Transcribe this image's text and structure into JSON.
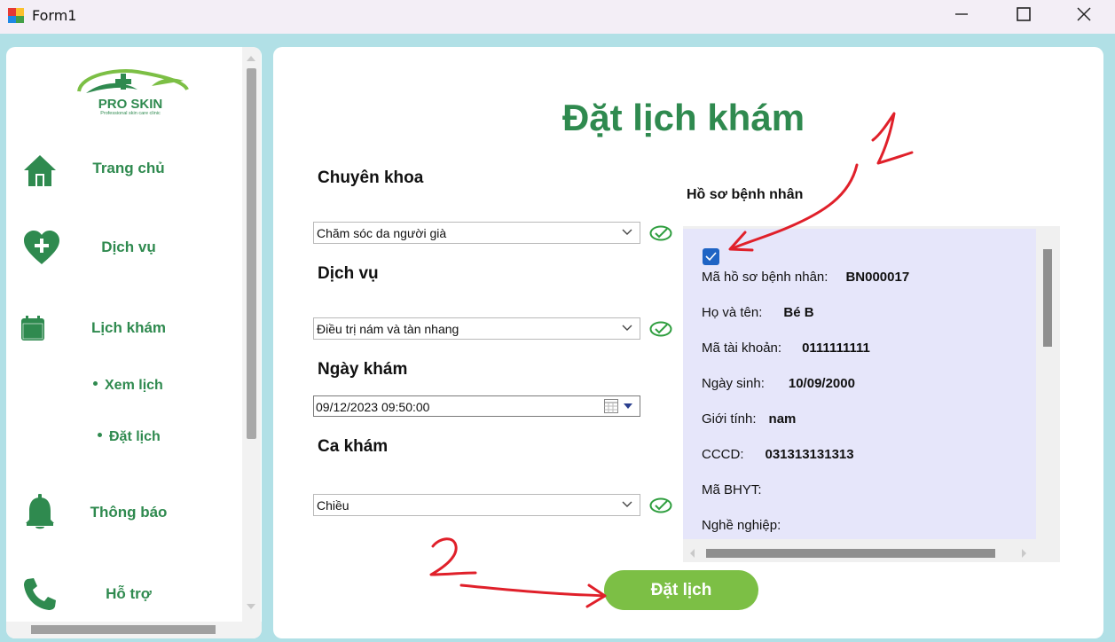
{
  "window": {
    "title": "Form1"
  },
  "colors": {
    "accent_green": "#2f8a4f",
    "button_green": "#7cbf45",
    "panel_lavender": "#e6e6fa",
    "annotation_red": "#e0202a"
  },
  "sidebar": {
    "logo_text": "PRO SKIN",
    "logo_tagline": "Professional skin care clinic",
    "items": [
      {
        "label": "Trang chủ",
        "icon": "home-icon"
      },
      {
        "label": "Dịch vụ",
        "icon": "heart-plus-icon"
      },
      {
        "label": "Lịch khám",
        "icon": "calendar-icon"
      },
      {
        "label": "Thông báo",
        "icon": "bell-icon"
      },
      {
        "label": "Hỗ trợ",
        "icon": "phone-icon"
      }
    ],
    "sub_items": [
      {
        "label": "Xem lịch"
      },
      {
        "label": "Đặt lịch"
      }
    ]
  },
  "main": {
    "title": "Đặt lịch khám",
    "specialty": {
      "label": "Chuyên khoa",
      "value": "Chăm sóc da người già"
    },
    "service": {
      "label": "Dịch vụ",
      "value": "Điều trị nám và tàn nhang"
    },
    "date": {
      "label": "Ngày khám",
      "value": "09/12/2023 09:50:00"
    },
    "shift": {
      "label": "Ca khám",
      "value": "Chiều"
    },
    "profile": {
      "heading": "Hồ sơ bệnh nhân",
      "checked": true,
      "fields": [
        {
          "label": "Mã hồ sơ bệnh nhân:",
          "value": "BN000017"
        },
        {
          "label": "Họ và tên:",
          "value": "Bé B"
        },
        {
          "label": "Mã tài khoản:",
          "value": "0111111111"
        },
        {
          "label": "Ngày sinh:",
          "value": "10/09/2000"
        },
        {
          "label": "Giới tính:",
          "value": "nam"
        },
        {
          "label": "CCCD:",
          "value": "031313131313"
        },
        {
          "label": "Mã BHYT:",
          "value": ""
        },
        {
          "label": "Nghề nghiệp:",
          "value": ""
        }
      ]
    },
    "book_button": "Đặt lịch"
  },
  "annotations": {
    "marker_1": "1",
    "marker_2": "2"
  }
}
